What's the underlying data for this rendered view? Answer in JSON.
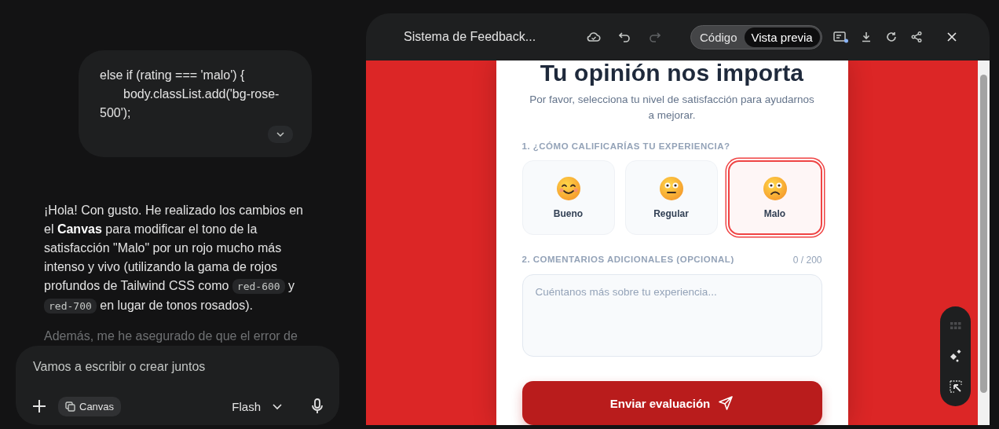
{
  "chat": {
    "user_code": [
      {
        "text": "else if (rating === 'malo') {",
        "indent": false
      },
      {
        "text": "body.classList.add('bg-rose-",
        "indent": true
      },
      {
        "text": "500');",
        "indent": false
      }
    ],
    "response": [
      {
        "kind": "text",
        "text": "¡Hola! Con gusto. He realizado los cambios en el **Canvas** para modificar el tono de la satisfacción \"Malo\" por un rojo mucho más intenso y vivo (utilizando la gama de rojos profundos de Tailwind CSS como"
      },
      {
        "kind": "code",
        "text": "red-600"
      },
      {
        "kind": "text",
        "text": "y"
      },
      {
        "kind": "code",
        "text": "red-700"
      },
      {
        "kind": "text",
        "text": "en lugar de tonos rosados)."
      }
    ],
    "faded_line": "Además, me he asegurado de que el error de"
  },
  "composer": {
    "placeholder": "Vamos a escribir o crear juntos",
    "tool_chip": "Canvas",
    "model": "Flash"
  },
  "canvas": {
    "title": "Sistema de Feedback...",
    "actions": [
      {
        "kind": "cloud",
        "disabled": false
      },
      {
        "kind": "undo",
        "disabled": false
      },
      {
        "kind": "redo",
        "disabled": true
      }
    ],
    "view_toggle": [
      {
        "label": "Código",
        "selected": false
      },
      {
        "label": "Vista previa",
        "selected": true
      }
    ]
  },
  "preview": {
    "title": "Tu opinión nos importa",
    "subtitle": "Por favor, selecciona tu nivel de satisfacción para ayudarnos a mejorar.",
    "question_1": "1. ¿CÓMO CALIFICARÍAS TU EXPERIENCIA?",
    "ratings": [
      {
        "kind": "happy",
        "label": "Bueno",
        "selected": false
      },
      {
        "kind": "neutral",
        "label": "Regular",
        "selected": false
      },
      {
        "kind": "sad",
        "label": "Malo",
        "selected": true
      }
    ],
    "question_2": "2. COMENTARIOS ADICIONALES (OPCIONAL)",
    "counter": "0 / 200",
    "comment": {
      "placeholder": "Cuéntanos más sobre tu experiencia..."
    },
    "submit": "Enviar evaluación"
  }
}
